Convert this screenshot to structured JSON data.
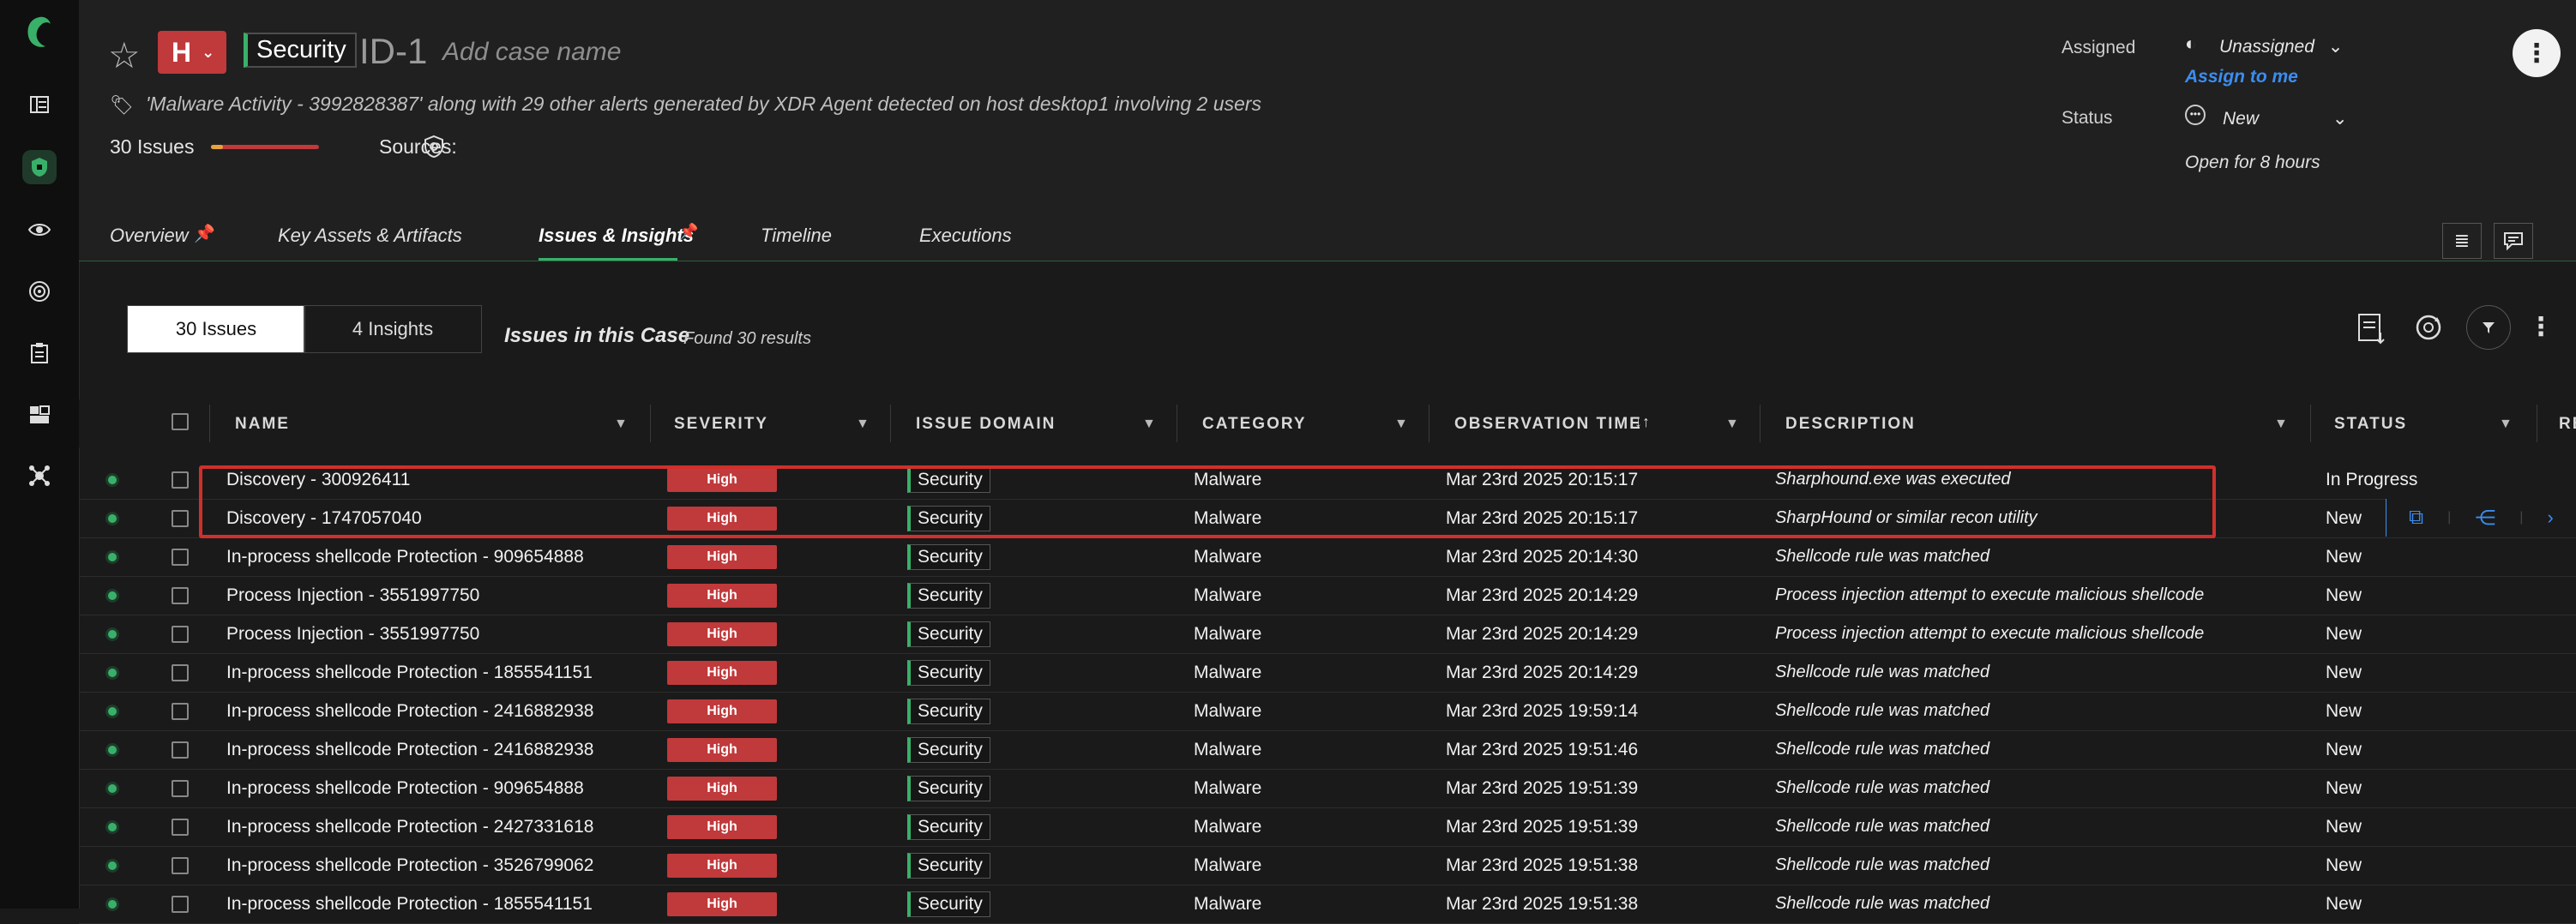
{
  "case": {
    "severity": "H",
    "domain_tag": "Security",
    "case_id": "ID-1",
    "name_placeholder": "Add case name",
    "description": "'Malware Activity - 3992828387' along with 29 other alerts generated by XDR Agent detected on host desktop1 involving 2 users",
    "issues_count_label": "30 Issues",
    "sources_label": "Sources:"
  },
  "assignment": {
    "assigned_label": "Assigned",
    "assigned_value": "Unassigned",
    "assign_to_me": "Assign to me",
    "status_label": "Status",
    "status_value": "New",
    "open_duration": "Open for 8 hours"
  },
  "tabs": [
    {
      "label": "Overview"
    },
    {
      "label": "Key Assets & Artifacts"
    },
    {
      "label": "Issues & Insights"
    },
    {
      "label": "Timeline"
    },
    {
      "label": "Executions"
    }
  ],
  "toolbar": {
    "issues_seg": "30 Issues",
    "insights_seg": "4 Insights",
    "section_title": "Issues in this Case",
    "result_count": "Found 30 results"
  },
  "columns": {
    "name": "NAME",
    "severity": "SEVERITY",
    "issue_domain": "ISSUE DOMAIN",
    "category": "CATEGORY",
    "observation_time": "OBSERVATION TIME",
    "description": "DESCRIPTION",
    "status": "STATUS",
    "extra": "RE"
  },
  "rows": [
    {
      "name": "Discovery - 300926411",
      "severity": "High",
      "domain": "Security",
      "category": "Malware",
      "time": "Mar 23rd 2025 20:15:17",
      "description": "Sharphound.exe was executed",
      "status": "In Progress"
    },
    {
      "name": "Discovery - 1747057040",
      "severity": "High",
      "domain": "Security",
      "category": "Malware",
      "time": "Mar 23rd 2025 20:15:17",
      "description": "SharpHound or similar recon utility",
      "status": "New"
    },
    {
      "name": "In-process shellcode Protection - 909654888",
      "severity": "High",
      "domain": "Security",
      "category": "Malware",
      "time": "Mar 23rd 2025 20:14:30",
      "description": "Shellcode rule was matched",
      "status": "New"
    },
    {
      "name": "Process Injection - 3551997750",
      "severity": "High",
      "domain": "Security",
      "category": "Malware",
      "time": "Mar 23rd 2025 20:14:29",
      "description": "Process injection attempt to execute malicious shellcode",
      "status": "New"
    },
    {
      "name": "Process Injection - 3551997750",
      "severity": "High",
      "domain": "Security",
      "category": "Malware",
      "time": "Mar 23rd 2025 20:14:29",
      "description": "Process injection attempt to execute malicious shellcode",
      "status": "New"
    },
    {
      "name": "In-process shellcode Protection - 1855541151",
      "severity": "High",
      "domain": "Security",
      "category": "Malware",
      "time": "Mar 23rd 2025 20:14:29",
      "description": "Shellcode rule was matched",
      "status": "New"
    },
    {
      "name": "In-process shellcode Protection - 2416882938",
      "severity": "High",
      "domain": "Security",
      "category": "Malware",
      "time": "Mar 23rd 2025 19:59:14",
      "description": "Shellcode rule was matched",
      "status": "New"
    },
    {
      "name": "In-process shellcode Protection - 2416882938",
      "severity": "High",
      "domain": "Security",
      "category": "Malware",
      "time": "Mar 23rd 2025 19:51:46",
      "description": "Shellcode rule was matched",
      "status": "New"
    },
    {
      "name": "In-process shellcode Protection - 909654888",
      "severity": "High",
      "domain": "Security",
      "category": "Malware",
      "time": "Mar 23rd 2025 19:51:39",
      "description": "Shellcode rule was matched",
      "status": "New"
    },
    {
      "name": "In-process shellcode Protection - 2427331618",
      "severity": "High",
      "domain": "Security",
      "category": "Malware",
      "time": "Mar 23rd 2025 19:51:39",
      "description": "Shellcode rule was matched",
      "status": "New"
    },
    {
      "name": "In-process shellcode Protection - 3526799062",
      "severity": "High",
      "domain": "Security",
      "category": "Malware",
      "time": "Mar 23rd 2025 19:51:38",
      "description": "Shellcode rule was matched",
      "status": "New"
    },
    {
      "name": "In-process shellcode Protection - 1855541151",
      "severity": "High",
      "domain": "Security",
      "category": "Malware",
      "time": "Mar 23rd 2025 19:51:38",
      "description": "Shellcode rule was matched",
      "status": "New"
    }
  ],
  "colors": {
    "accent_green": "#39b069",
    "severity_high": "#c0393b",
    "highlight_box": "#d0302c",
    "link_blue": "#3b8df0"
  }
}
